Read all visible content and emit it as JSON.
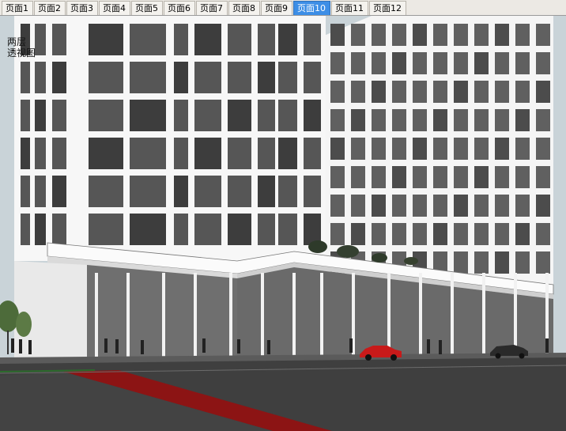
{
  "tabs": [
    {
      "label": "页面1",
      "active": false
    },
    {
      "label": "页面2",
      "active": false
    },
    {
      "label": "页面3",
      "active": false
    },
    {
      "label": "页面4",
      "active": false
    },
    {
      "label": "页面5",
      "active": false
    },
    {
      "label": "页面6",
      "active": false
    },
    {
      "label": "页面7",
      "active": false
    },
    {
      "label": "页面8",
      "active": false
    },
    {
      "label": "页面9",
      "active": false
    },
    {
      "label": "页面10",
      "active": true
    },
    {
      "label": "页面11",
      "active": false
    },
    {
      "label": "页面12",
      "active": false
    }
  ],
  "scene": {
    "label_line1": "两层",
    "label_line2": "透视图"
  },
  "colors": {
    "sky": "#c9d3d8",
    "tab_active": "#3d8ee6",
    "frame": "#f7f7f7",
    "glass": "#4a4a4a",
    "road": "#3f3f3f",
    "red_stripe": "#8c1414",
    "car": "#c81a1a"
  }
}
